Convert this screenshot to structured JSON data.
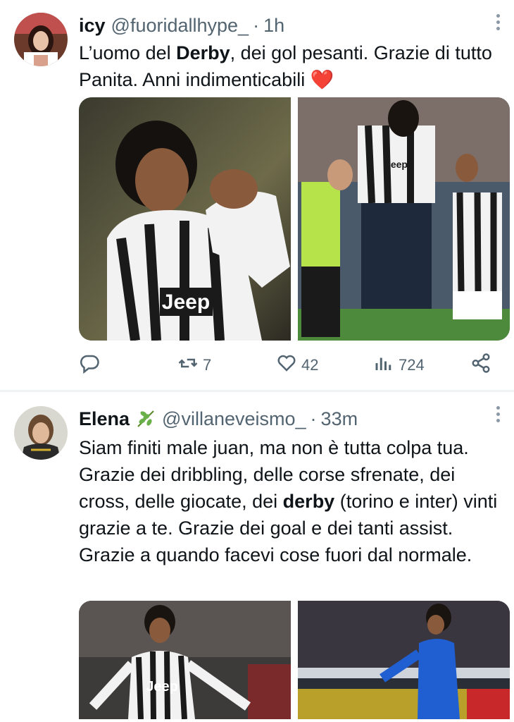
{
  "tweets": [
    {
      "name": "icy",
      "handle": "@fuoridallhype_",
      "dot": "·",
      "time": "1h",
      "text_parts": [
        "L’uomo del ",
        "Derby",
        ", dei gol pesanti. Grazie di tutto Panita. Anni indimenticabili "
      ],
      "emoji": "❤️",
      "replies": "",
      "retweets": "7",
      "likes": "42",
      "views": "724"
    },
    {
      "name": "Elena",
      "handle": "@villaneveismo_",
      "dot": "·",
      "time": "33m",
      "text_parts": [
        "Siam finiti male juan, ma non è tutta colpa tua. Grazie dei dribbling, delle corse sfrenate, dei cross, delle giocate, dei ",
        "derby",
        " (torino e inter) vinti grazie a te. Grazie dei goal e dei tanti assist. Grazie a quando facevi cose fuori dal normale."
      ]
    }
  ],
  "photos": {
    "t1_left_text": "Jeep",
    "t1_right_text": "Jeep",
    "t2_left_text": "Jeep"
  },
  "icons": {
    "reply": "reply-icon",
    "retweet": "retweet-icon",
    "like": "heart-icon",
    "views": "views-icon",
    "share": "share-icon",
    "more": "more-icon",
    "leaf": "leaf-emoji-icon"
  },
  "colors": {
    "text": "#0f1419",
    "secondary": "#536471",
    "separator": "#eff3f4",
    "heart_emoji": "#e0245e",
    "juve_black": "#1a1a1a",
    "inter_blue": "#1f5fd1"
  }
}
